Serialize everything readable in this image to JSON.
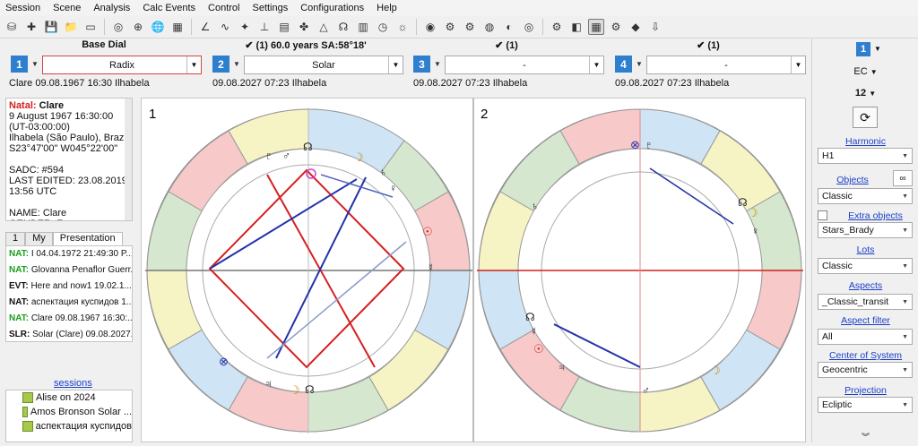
{
  "menu": [
    "Session",
    "Scene",
    "Analysis",
    "Calc Events",
    "Control",
    "Settings",
    "Configurations",
    "Help"
  ],
  "toolbar_icons": [
    "database-icon",
    "new-chart-icon",
    "save-icon",
    "folder-icon",
    "page-icon",
    "circle-icon",
    "globe-red-icon",
    "globe-blue-icon",
    "calculator-icon",
    "angle-icon",
    "wave-icon",
    "star-icon",
    "axis-icon",
    "table-icon",
    "clover-icon",
    "aspect-icon",
    "node-icon",
    "calendar-icon",
    "clock-icon",
    "astronomer-icon",
    "eye-icon",
    "gear-blue-icon",
    "gear-icon",
    "dial-icon",
    "theme-icon",
    "target-icon",
    "gear-dial-icon",
    "chart-icon",
    "grid-icon",
    "settings-icon",
    "palette-icon",
    "export-icon"
  ],
  "dials": [
    {
      "num": "1",
      "title": "Base Dial",
      "checked": false,
      "select": "Radix",
      "info": "Clare 09.08.1967 16:30 Ilhabela"
    },
    {
      "num": "2",
      "title": "(1) 60.0 years SA:58°18'",
      "checked": true,
      "select": "Solar",
      "info": "09.08.2027 07:23 Ilhabela"
    },
    {
      "num": "3",
      "title": "(1)",
      "checked": true,
      "select": "-",
      "info": "09.08.2027 07:23 Ilhabela"
    },
    {
      "num": "4",
      "title": "(1)",
      "checked": true,
      "select": "-",
      "info": "09.08.2027 07:23 Ilhabela"
    }
  ],
  "info_panel": {
    "natal_label": "Natal:",
    "name": "Clare",
    "lines": [
      "9 August 1967 16:30:00",
      "(UT-03:00:00)",
      "Ilhabela (São Paulo), Brazil",
      "S23°47'00\" W045°22'00\"",
      "",
      "SADC: #594",
      "LAST EDITED: 23.08.2019",
      "13:56 UTC",
      "",
      "NAME: Clare",
      "GENDER: F"
    ]
  },
  "tabs": [
    "1",
    "My",
    "Presentation"
  ],
  "events": [
    {
      "tag": "NAT:",
      "green": true,
      "text": "I 04.04.1972 21:49:30 P..."
    },
    {
      "tag": "NAT:",
      "green": true,
      "text": "Glovanna Penaflor Guerr..."
    },
    {
      "tag": "EVT:",
      "green": false,
      "text": "Here and now1 19.02.1..."
    },
    {
      "tag": "NAT:",
      "green": false,
      "text": "аспектация куспидов 1..."
    },
    {
      "tag": "NAT:",
      "green": true,
      "text": "Clare 09.08.1967 16:30:..."
    },
    {
      "tag": "SLR:",
      "green": false,
      "text": "Solar (Clare) 09.08.2027..."
    }
  ],
  "sessions_label": "sessions",
  "sessions": [
    "Alise on 2024",
    "Amos Bronson Solar ...",
    "аспектация куспидов"
  ],
  "chart_labels": {
    "left": "1",
    "right": "2"
  },
  "right_panel": {
    "dial_num": "1",
    "ec": "EC",
    "houses": "12",
    "harmonic_label": "Harmonic",
    "harmonic": "H1",
    "objects_label": "Objects",
    "objects": "Classic",
    "extra_label": "Extra objects",
    "extra": "Stars_Brady",
    "lots_label": "Lots",
    "lots": "Classic",
    "aspects_label": "Aspects",
    "aspects": "_Classic_transit",
    "filter_label": "Aspect filter",
    "filter": "All",
    "center_label": "Center of System",
    "center": "Geocentric",
    "projection_label": "Projection",
    "projection": "Ecliptic"
  },
  "colors": {
    "dial_blue": "#2f7fcf",
    "aspect_red": "#d42020",
    "aspect_blue": "#2233aa",
    "link_blue": "#1a3fc8"
  }
}
